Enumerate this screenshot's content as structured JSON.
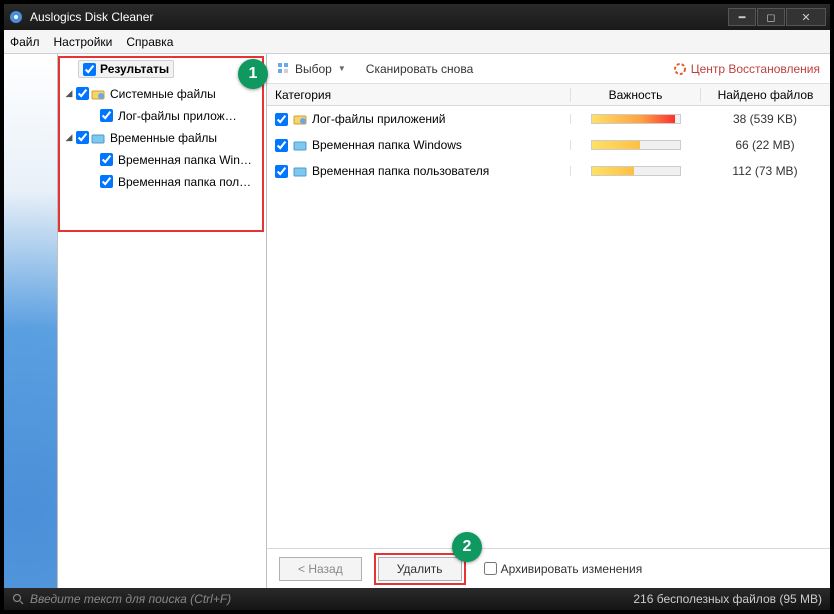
{
  "app": {
    "title": "Auslogics Disk Cleaner"
  },
  "menu": {
    "file": "Файл",
    "settings": "Настройки",
    "help": "Справка"
  },
  "tree": {
    "header": "Результаты",
    "system_files": "Системные файлы",
    "log_files": "Лог-файлы прилож…",
    "temp_files": "Временные файлы",
    "temp_win": "Временная папка Win…",
    "temp_user": "Временная папка пол…"
  },
  "toolbar": {
    "select": "Выбор",
    "rescan": "Сканировать снова",
    "recovery": "Центр Восстановления"
  },
  "columns": {
    "category": "Категория",
    "importance": "Важность",
    "found": "Найдено файлов"
  },
  "rows": {
    "r0": {
      "name": "Лог-файлы приложений",
      "found": "38 (539 KB)"
    },
    "r1": {
      "name": "Временная папка Windows",
      "found": "66 (22 MB)"
    },
    "r2": {
      "name": "Временная папка пользователя",
      "found": "112 (73 MB)"
    }
  },
  "buttons": {
    "back": "< Назад",
    "delete": "Удалить",
    "archive": "Архивировать изменения"
  },
  "search": {
    "placeholder": "Введите текст для поиска (Ctrl+F)"
  },
  "status": {
    "summary": "216 бесполезных файлов (95 MB)"
  },
  "callouts": {
    "c1": "1",
    "c2": "2"
  }
}
